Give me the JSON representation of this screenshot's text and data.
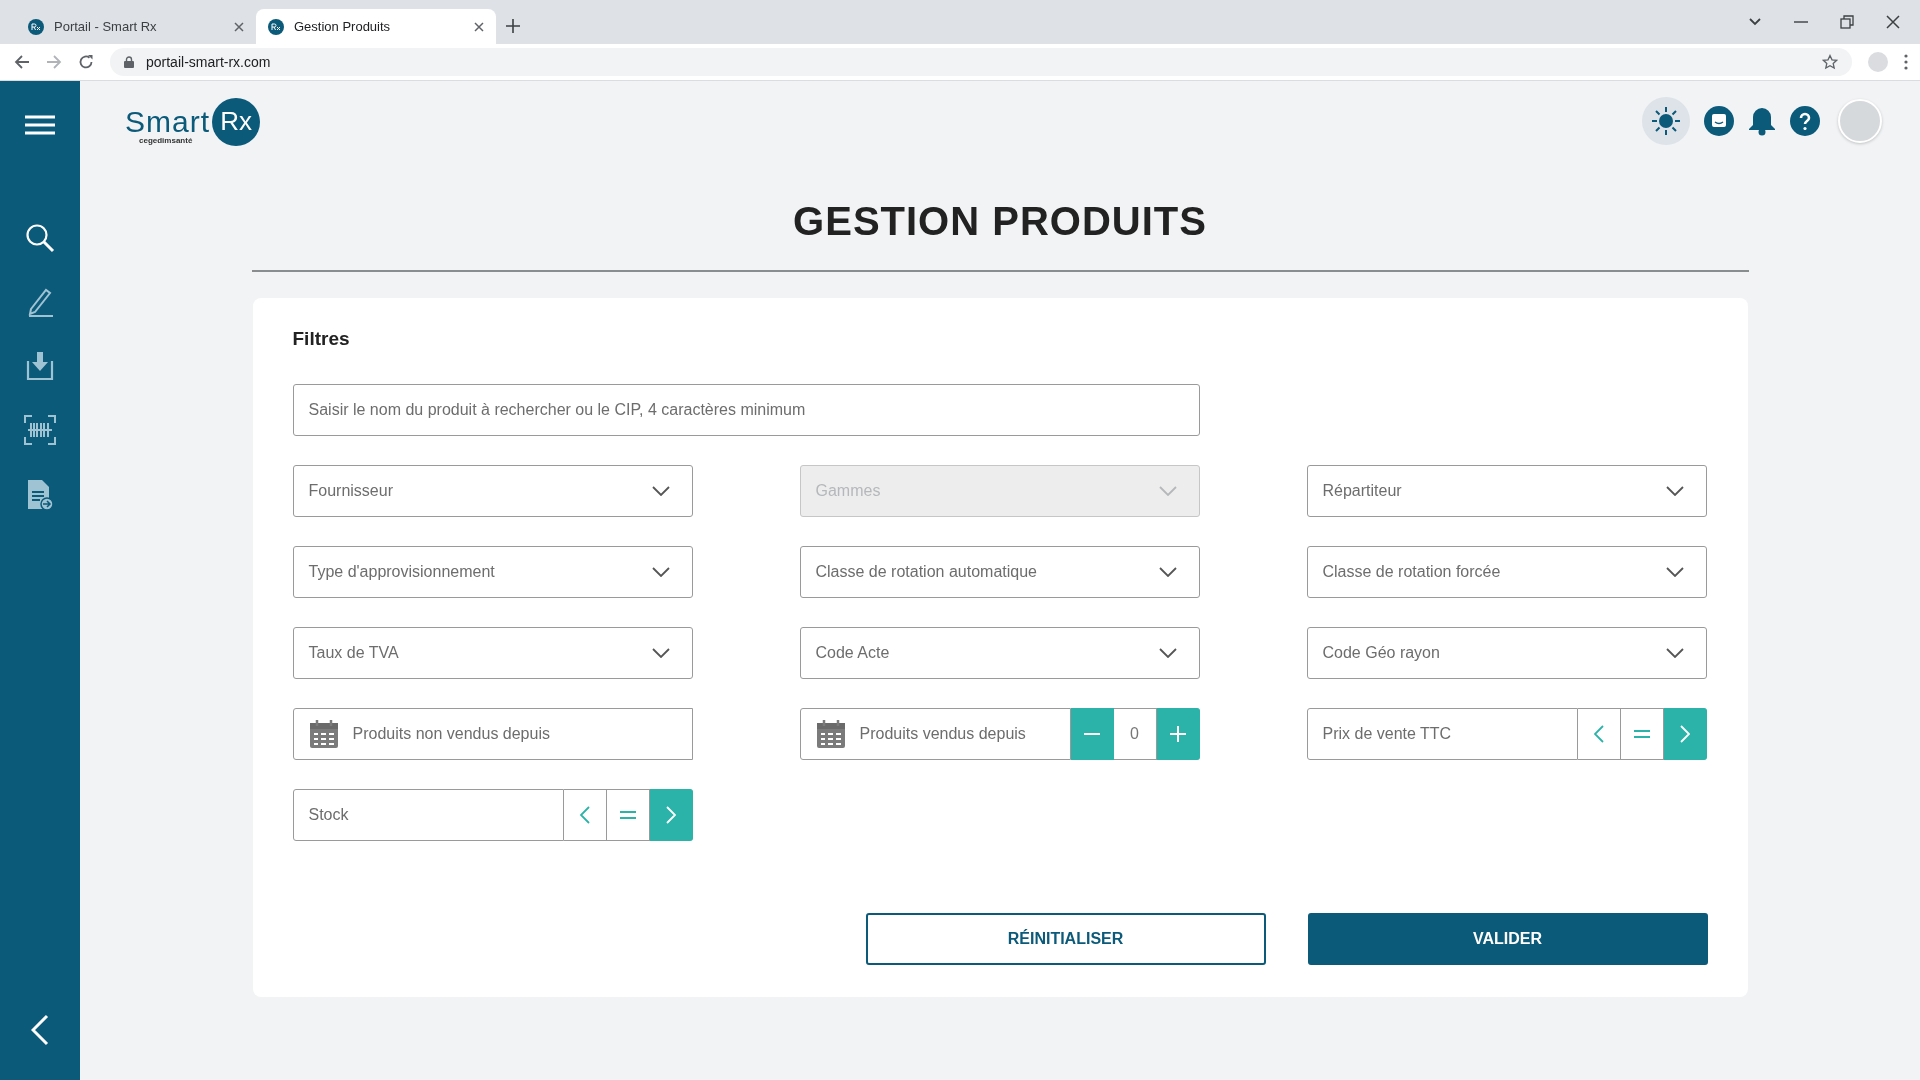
{
  "browser": {
    "tabs": [
      {
        "title": "Portail - Smart Rx",
        "selected": false
      },
      {
        "title": "Gestion Produits",
        "selected": true
      }
    ],
    "address": "portail-smart-rx.com"
  },
  "logo": {
    "word": "Smart",
    "badge": "Rx",
    "tagline": "cegedimsanté"
  },
  "page": {
    "title": "GESTION PRODUITS"
  },
  "filters": {
    "title": "Filtres",
    "search": {
      "placeholder": "Saisir le nom du produit à rechercher ou le CIP, 4 caractères minimum"
    },
    "fields": [
      {
        "kind": "select",
        "placeholder": "Fournisseur",
        "disabled": false
      },
      {
        "kind": "select",
        "placeholder": "Gammes",
        "disabled": true
      },
      {
        "kind": "select",
        "placeholder": "Répartiteur",
        "disabled": false
      },
      {
        "kind": "select",
        "placeholder": "Type d'approvisionnement",
        "disabled": false
      },
      {
        "kind": "select",
        "placeholder": "Classe de rotation automatique",
        "disabled": false
      },
      {
        "kind": "select",
        "placeholder": "Classe de rotation forcée",
        "disabled": false
      },
      {
        "kind": "select",
        "placeholder": "Taux de TVA",
        "disabled": false
      },
      {
        "kind": "select",
        "placeholder": "Code Acte",
        "disabled": false
      },
      {
        "kind": "select",
        "placeholder": "Code Géo rayon",
        "disabled": false
      },
      {
        "kind": "date",
        "placeholder": "Produits non vendus depuis"
      },
      {
        "kind": "date-counter",
        "placeholder": "Produits vendus depuis",
        "value": "0"
      },
      {
        "kind": "compare",
        "placeholder": "Prix de vente TTC",
        "operators": [
          {
            "kind": "lt",
            "selected": false
          },
          {
            "kind": "eq",
            "selected": false
          },
          {
            "kind": "gt",
            "selected": true
          }
        ]
      },
      {
        "kind": "compare",
        "placeholder": "Stock",
        "operators": [
          {
            "kind": "lt",
            "selected": false
          },
          {
            "kind": "eq",
            "selected": false
          },
          {
            "kind": "gt",
            "selected": true
          }
        ]
      }
    ],
    "buttons": [
      {
        "kind": "secondary",
        "label": "RÉINITIALISER"
      },
      {
        "kind": "primary",
        "label": "VALIDER"
      }
    ]
  }
}
